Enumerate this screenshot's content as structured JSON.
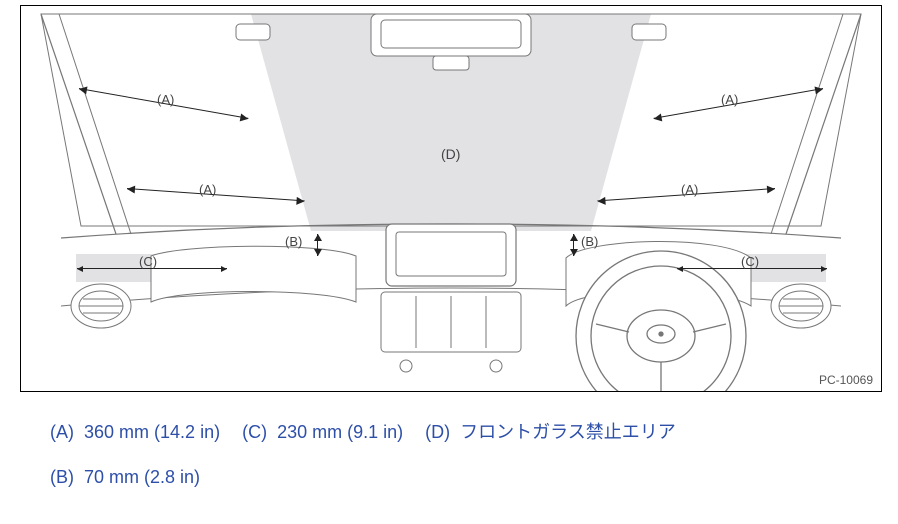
{
  "figure": {
    "labels": {
      "A": "(A)",
      "B": "(B)",
      "C": "(C)",
      "D": "(D)"
    },
    "code": "PC-10069"
  },
  "legend": {
    "A": {
      "key": "(A)",
      "text": "360 mm (14.2 in)"
    },
    "C": {
      "key": "(C)",
      "text": "230 mm (9.1 in)"
    },
    "D": {
      "key": "(D)",
      "text": "フロントガラス禁止エリア"
    },
    "B": {
      "key": "(B)",
      "text": "70 mm (2.8 in)"
    }
  }
}
